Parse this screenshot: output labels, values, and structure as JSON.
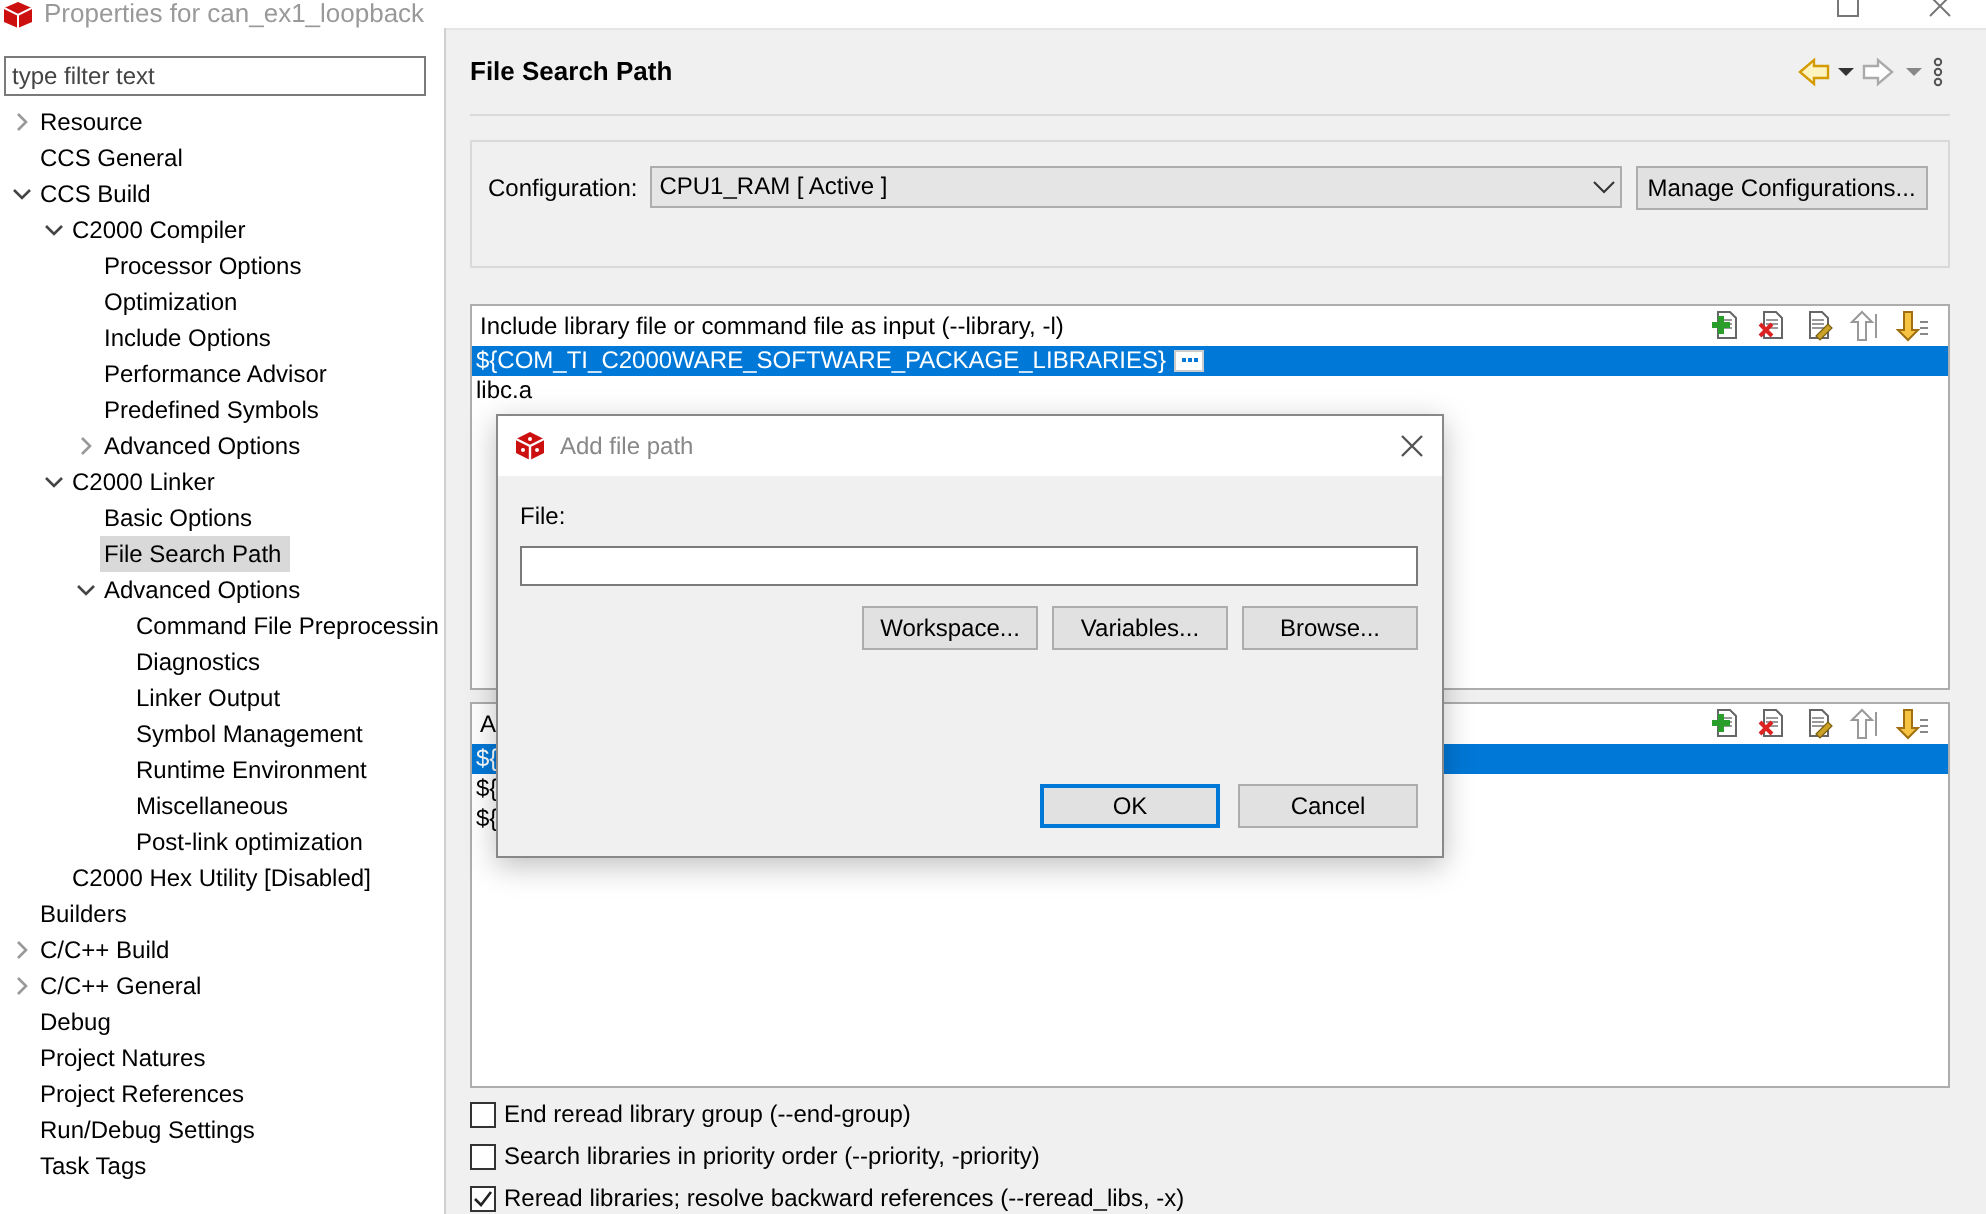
{
  "window": {
    "title": "Properties for can_ex1_loopback"
  },
  "filter": {
    "placeholder": "type filter text"
  },
  "tree": {
    "items": [
      {
        "label": "Resource",
        "expanded": false
      },
      {
        "label": "CCS General"
      },
      {
        "label": "CCS Build",
        "expanded": true,
        "children": [
          {
            "label": "C2000 Compiler",
            "expanded": true,
            "children": [
              {
                "label": "Processor Options"
              },
              {
                "label": "Optimization"
              },
              {
                "label": "Include Options"
              },
              {
                "label": "Performance Advisor"
              },
              {
                "label": "Predefined Symbols"
              },
              {
                "label": "Advanced Options",
                "expanded": false
              }
            ]
          },
          {
            "label": "C2000 Linker",
            "expanded": true,
            "children": [
              {
                "label": "Basic Options"
              },
              {
                "label": "File Search Path",
                "selected": true
              },
              {
                "label": "Advanced Options",
                "expanded": true,
                "children": [
                  {
                    "label": "Command File Preprocessin"
                  },
                  {
                    "label": "Diagnostics"
                  },
                  {
                    "label": "Linker Output"
                  },
                  {
                    "label": "Symbol Management"
                  },
                  {
                    "label": "Runtime Environment"
                  },
                  {
                    "label": "Miscellaneous"
                  },
                  {
                    "label": "Post-link optimization"
                  }
                ]
              }
            ]
          },
          {
            "label": "C2000 Hex Utility  [Disabled]"
          }
        ]
      },
      {
        "label": "Builders"
      },
      {
        "label": "C/C++ Build",
        "expanded": false
      },
      {
        "label": "C/C++ General",
        "expanded": false
      },
      {
        "label": "Debug"
      },
      {
        "label": "Project Natures"
      },
      {
        "label": "Project References"
      },
      {
        "label": "Run/Debug Settings"
      },
      {
        "label": "Task Tags"
      }
    ]
  },
  "page": {
    "title": "File Search Path"
  },
  "configuration": {
    "label": "Configuration:",
    "value": "CPU1_RAM  [ Active ]",
    "button": "Manage Configurations..."
  },
  "lists": [
    {
      "header": "Include library file or command file as input (--library, -l)",
      "rows": [
        {
          "text": "${COM_TI_C2000WARE_SOFTWARE_PACKAGE_LIBRARIES}",
          "selected": true,
          "ellipsis_button": true
        },
        {
          "text": "libc.a",
          "selected": false
        }
      ]
    },
    {
      "header": "A",
      "rows": [
        {
          "text": "${",
          "selected": true
        },
        {
          "text": "${",
          "selected": false
        },
        {
          "text": "${",
          "selected": false
        }
      ]
    }
  ],
  "options": [
    {
      "label": "End reread library group (--end-group)",
      "checked": false
    },
    {
      "label": "Search libraries in priority order (--priority, -priority)",
      "checked": false
    },
    {
      "label": "Reread libraries; resolve backward references (--reread_libs, -x)",
      "checked": true
    }
  ],
  "dialog": {
    "title": "Add file path",
    "field_label": "File:",
    "buttons": [
      {
        "label": "Workspace..."
      },
      {
        "label": "Variables..."
      },
      {
        "label": "Browse..."
      }
    ],
    "actions": [
      {
        "label": "OK",
        "default": true
      },
      {
        "label": "Cancel",
        "default": false
      }
    ]
  }
}
